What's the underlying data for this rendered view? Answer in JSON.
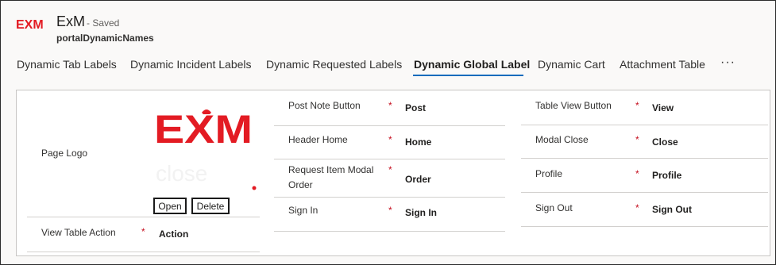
{
  "app": {
    "logo_text": "EXM",
    "title": "ExM",
    "status": "- Saved",
    "entity_name": "portalDynamicNames"
  },
  "tabs": [
    {
      "label": "Dynamic Tab Labels",
      "active": false
    },
    {
      "label": "Dynamic Incident Labels",
      "active": false
    },
    {
      "label": "Dynamic Requested Labels",
      "active": false
    },
    {
      "label": "Dynamic Global Label",
      "active": true
    },
    {
      "label": "Dynamic Cart",
      "active": false
    },
    {
      "label": "Attachment Table",
      "active": false
    }
  ],
  "more_label": "···",
  "form": {
    "page_logo_label": "Page Logo",
    "logo_image_text": "EXM",
    "open_button": "Open",
    "delete_button": "Delete",
    "required_marker": "*",
    "fields_left": [
      {
        "label": "View Table Action",
        "value": "Action"
      }
    ],
    "fields_middle": [
      {
        "label": "Post Note Button",
        "value": "Post"
      },
      {
        "label": "Header Home",
        "value": "Home"
      },
      {
        "label_line1": "Request Item Modal",
        "label_line2": "Order",
        "value": "Order"
      },
      {
        "label": "Sign In",
        "value": "Sign In"
      }
    ],
    "fields_right": [
      {
        "label": "Table View Button",
        "value": "View"
      },
      {
        "label": "Modal Close",
        "value": "Close"
      },
      {
        "label": "Profile",
        "value": "Profile"
      },
      {
        "label": "Sign Out",
        "value": "Sign Out"
      }
    ]
  },
  "colors": {
    "brand_red": "#e31b23",
    "active_tab_underline": "#0f6cbd",
    "required_red": "#c50f1f"
  }
}
